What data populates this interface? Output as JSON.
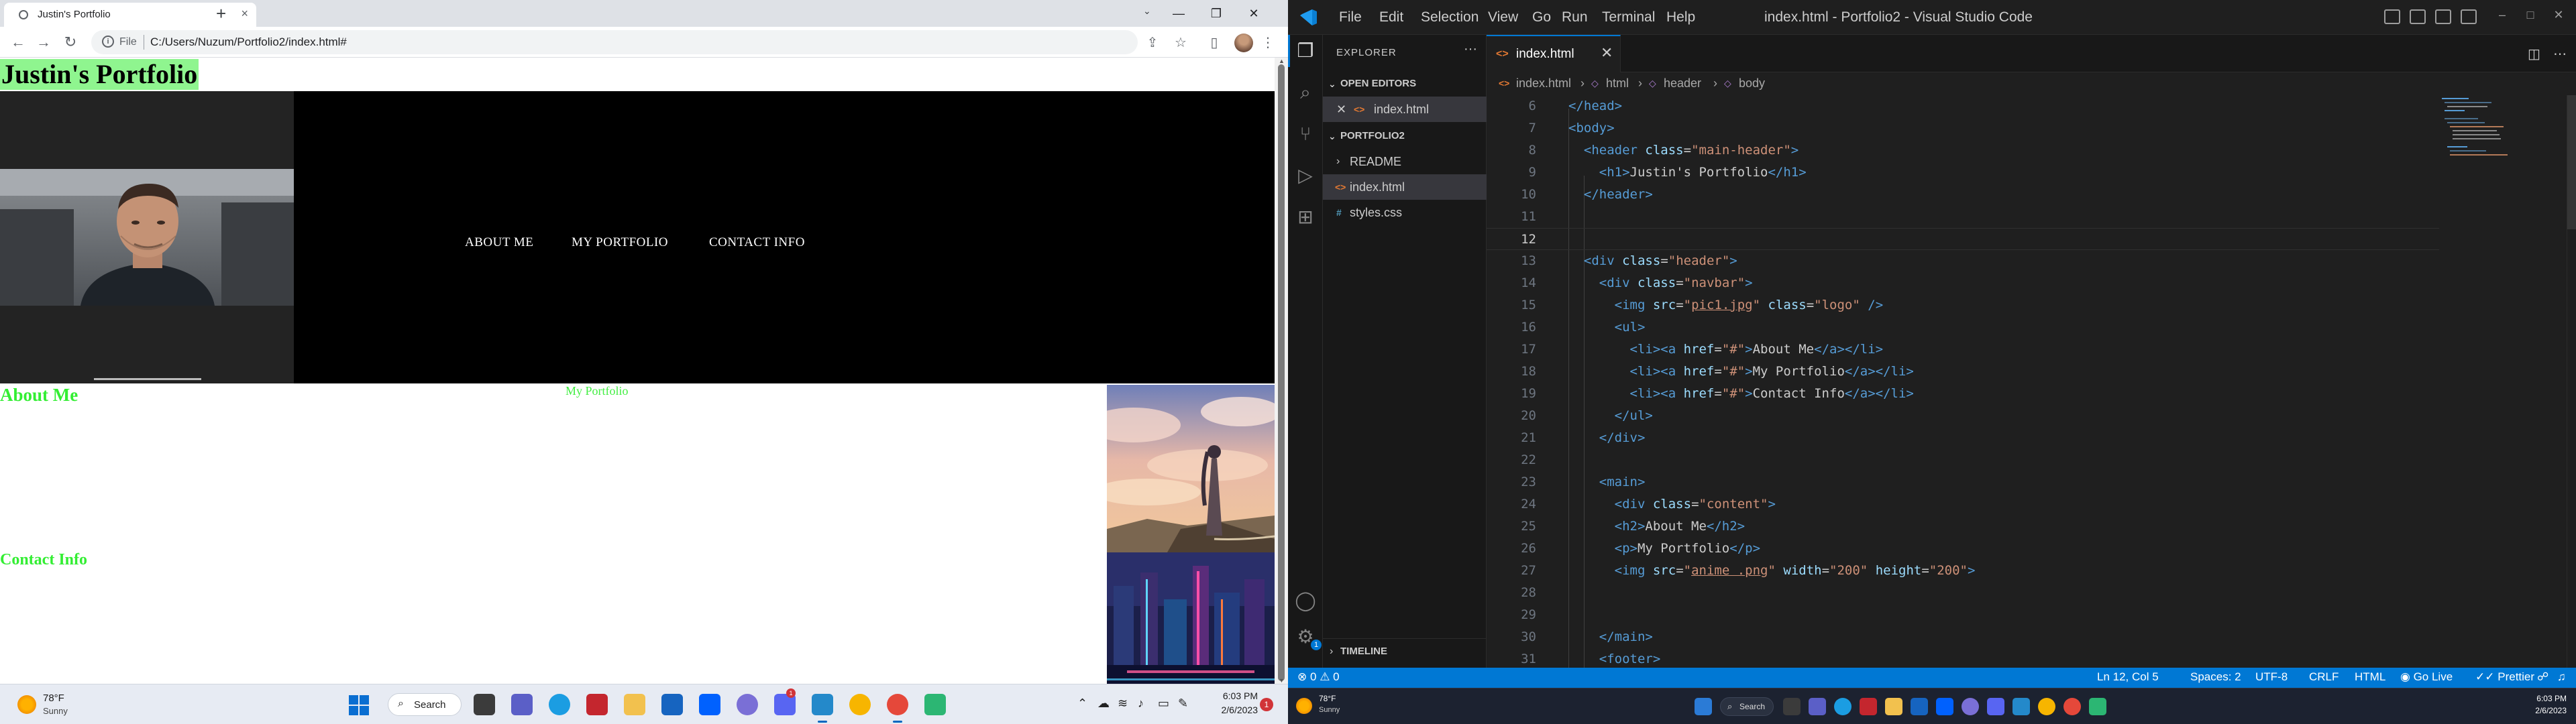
{
  "chrome": {
    "tab_title": "Justin's Portfolio",
    "tab_close": "×",
    "new_tab": "+",
    "url_scheme": "File",
    "url": "C:/Users/Nuzum/Portfolio2/index.html#",
    "back": "←",
    "forward": "→",
    "reload": "↻",
    "share": "⇪",
    "bookmark": "☆",
    "sidebar": "▯",
    "menu": "⋮",
    "tab_search": "⌄",
    "min": "—",
    "max": "❐",
    "close": "✕"
  },
  "portfolio": {
    "title": "Justin's Portfolio",
    "nav": [
      "ABOUT ME",
      "MY PORTFOLIO",
      "CONTACT INFO"
    ],
    "about_heading": "About Me",
    "portfolio_text": "My Portfolio",
    "contact_heading": "Contact Info"
  },
  "taskbar_left": {
    "temp": "78°F",
    "condition": "Sunny",
    "search": "Search",
    "time": "6:03 PM",
    "date": "2/6/2023",
    "notifications": "1"
  },
  "vscode": {
    "menu": [
      "File",
      "Edit",
      "Selection",
      "View",
      "Go",
      "Run",
      "Terminal",
      "Help"
    ],
    "window_title": "index.html - Portfolio2 - Visual Studio Code",
    "explorer_title": "EXPLORER",
    "explorer_more": "···",
    "open_editors": "OPEN EDITORS",
    "open_file": "index.html",
    "project": "PORTFOLIO2",
    "files": [
      "README",
      "index.html",
      "styles.css"
    ],
    "timeline": "TIMELINE",
    "tab_label": "index.html",
    "tab_close": "✕",
    "breadcrumb": [
      "index.html",
      "html",
      "header",
      "body"
    ],
    "account_badge": "1",
    "code_lines": [
      {
        "n": "6",
        "html": "<span class='t'>&lt;/head&gt;</span>"
      },
      {
        "n": "7",
        "html": "<span class='t'>&lt;body&gt;</span>"
      },
      {
        "n": "8",
        "html": "  <span class='t'>&lt;header</span> <span class='a'>class</span><span class='x'>=</span><span class='s'>\"main-header\"</span><span class='t'>&gt;</span>"
      },
      {
        "n": "9",
        "html": "    <span class='t'>&lt;h1&gt;</span><span class='x'>Justin's Portfolio</span><span class='t'>&lt;/h1&gt;</span>"
      },
      {
        "n": "10",
        "html": "  <span class='t'>&lt;/header&gt;</span>"
      },
      {
        "n": "11",
        "html": ""
      },
      {
        "n": "12",
        "html": ""
      },
      {
        "n": "13",
        "html": "  <span class='t'>&lt;div</span> <span class='a'>class</span><span class='x'>=</span><span class='s'>\"header\"</span><span class='t'>&gt;</span>"
      },
      {
        "n": "14",
        "html": "    <span class='t'>&lt;div</span> <span class='a'>class</span><span class='x'>=</span><span class='s'>\"navbar\"</span><span class='t'>&gt;</span>"
      },
      {
        "n": "15",
        "html": "      <span class='t'>&lt;img</span> <span class='a'>src</span><span class='x'>=</span><span class='s'>\"<span class='u'>pic1.jpg</span>\"</span> <span class='a'>class</span><span class='x'>=</span><span class='s'>\"logo\"</span> <span class='t'>/&gt;</span>"
      },
      {
        "n": "16",
        "html": "      <span class='t'>&lt;ul&gt;</span>"
      },
      {
        "n": "17",
        "html": "        <span class='t'>&lt;li&gt;&lt;a</span> <span class='a'>href</span><span class='x'>=</span><span class='s'>\"#\"</span><span class='t'>&gt;</span><span class='x'>About Me</span><span class='t'>&lt;/a&gt;&lt;/li&gt;</span>"
      },
      {
        "n": "18",
        "html": "        <span class='t'>&lt;li&gt;&lt;a</span> <span class='a'>href</span><span class='x'>=</span><span class='s'>\"#\"</span><span class='t'>&gt;</span><span class='x'>My Portfolio</span><span class='t'>&lt;/a&gt;&lt;/li&gt;</span>"
      },
      {
        "n": "19",
        "html": "        <span class='t'>&lt;li&gt;&lt;a</span> <span class='a'>href</span><span class='x'>=</span><span class='s'>\"#\"</span><span class='t'>&gt;</span><span class='x'>Contact Info</span><span class='t'>&lt;/a&gt;&lt;/li&gt;</span>"
      },
      {
        "n": "20",
        "html": "      <span class='t'>&lt;/ul&gt;</span>"
      },
      {
        "n": "21",
        "html": "    <span class='t'>&lt;/div&gt;</span>"
      },
      {
        "n": "22",
        "html": ""
      },
      {
        "n": "23",
        "html": "    <span class='t'>&lt;main&gt;</span>"
      },
      {
        "n": "24",
        "html": "      <span class='t'>&lt;div</span> <span class='a'>class</span><span class='x'>=</span><span class='s'>\"content\"</span><span class='t'>&gt;</span>"
      },
      {
        "n": "25",
        "html": "      <span class='t'>&lt;h2&gt;</span><span class='x'>About Me</span><span class='t'>&lt;/h2&gt;</span>"
      },
      {
        "n": "26",
        "html": "      <span class='t'>&lt;p&gt;</span><span class='x'>My Portfolio</span><span class='t'>&lt;/p&gt;</span>"
      },
      {
        "n": "27",
        "html": "      <span class='t'>&lt;img</span> <span class='a'>src</span><span class='x'>=</span><span class='s'>\"<span class='u'>anime .png</span>\"</span> <span class='a'>width</span><span class='x'>=</span><span class='s'>\"200\"</span> <span class='a'>height</span><span class='x'>=</span><span class='s'>\"200\"</span><span class='t'>&gt;</span>"
      },
      {
        "n": "28",
        "html": ""
      },
      {
        "n": "29",
        "html": ""
      },
      {
        "n": "30",
        "html": "    <span class='t'>&lt;/main&gt;</span>"
      },
      {
        "n": "31",
        "html": "    <span class='t'>&lt;footer&gt;</span>"
      }
    ],
    "status": {
      "errors": "0",
      "warnings": "0",
      "position": "Ln 12, Col 5",
      "spaces": "Spaces: 2",
      "encoding": "UTF-8",
      "eol": "CRLF",
      "language": "HTML",
      "golive": "Go Live",
      "prettier": "Prettier"
    }
  },
  "taskbar_right": {
    "temp": "78°F",
    "condition": "Sunny",
    "search": "Search",
    "time": "6:03 PM",
    "date": "2/6/2023"
  },
  "colors": {
    "title_bg": "#8ff58f",
    "heading_green": "#33ee33",
    "vscode_accent": "#0078d4"
  }
}
